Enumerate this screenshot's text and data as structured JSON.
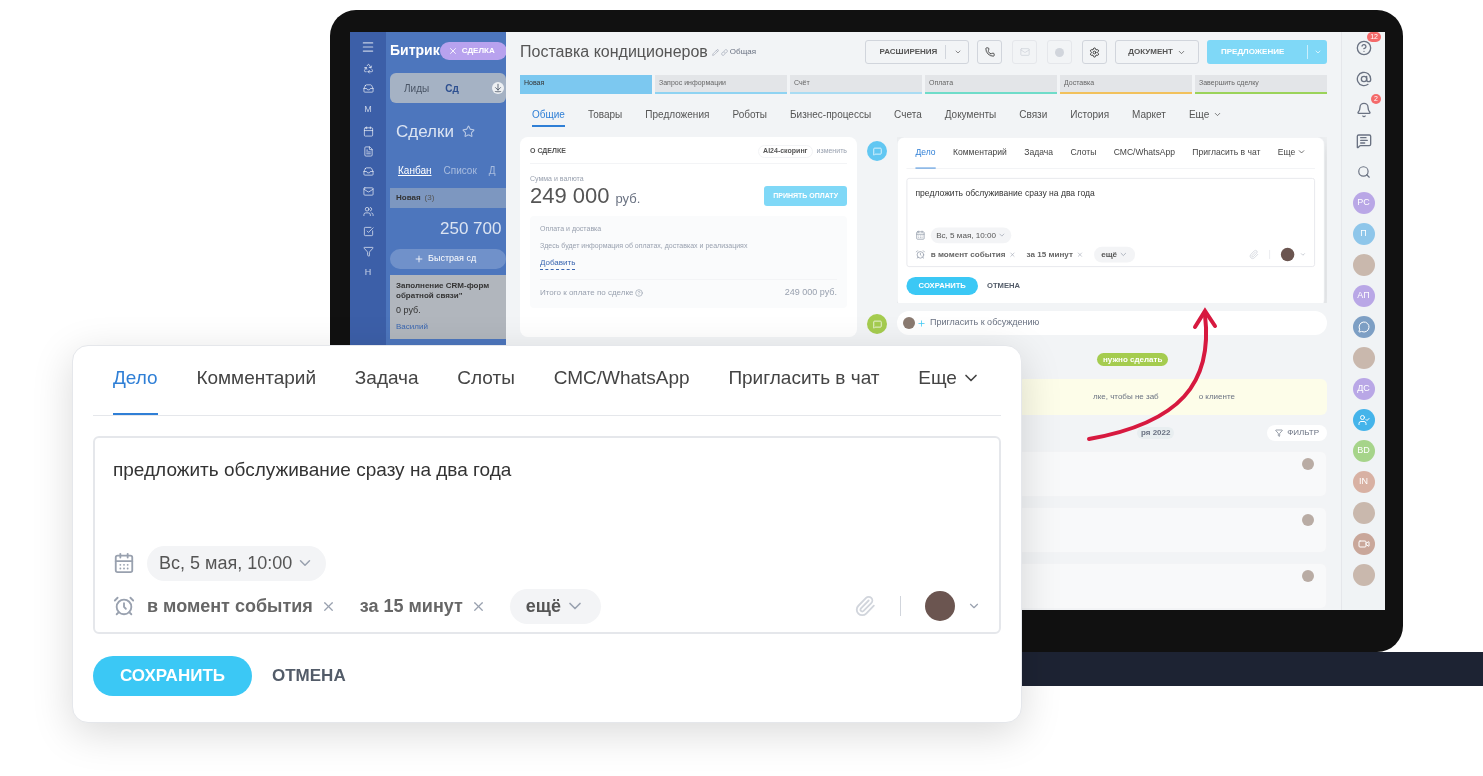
{
  "sidebar": {
    "logo_text": "Битрик",
    "slider_label": "СДЕЛКА",
    "letters": [
      "М",
      "Н"
    ],
    "tabs": [
      {
        "label": "Лиды",
        "selected": false
      },
      {
        "label": "Сд",
        "selected": true
      }
    ],
    "heading": "Сделки",
    "views": [
      {
        "label": "Канбан",
        "selected": true
      },
      {
        "label": "Список",
        "selected": false
      },
      {
        "label": "Д",
        "selected": false
      }
    ],
    "column": {
      "title": "Новая",
      "count": "(3)",
      "sum": "250 700",
      "quick_add": "Быстрая сд"
    },
    "card": {
      "title": [
        "Заполнение CRM-форм",
        "обратной связи\""
      ],
      "amount": "0 руб.",
      "person": "Василий"
    }
  },
  "header": {
    "title": "Поставка кондиционеров",
    "category": "Общая",
    "extensions": "РАСШИРЕНИЯ",
    "document": "ДОКУМЕНТ",
    "offer": "ПРЕДЛОЖЕНИЕ"
  },
  "stages": [
    {
      "label": "Новая",
      "selected": true,
      "color": "#7cc8f0"
    },
    {
      "label": "Запрос информации",
      "selected": false,
      "color": "#8fd3f2"
    },
    {
      "label": "Счёт",
      "selected": false,
      "color": "#a9dcf3"
    },
    {
      "label": "Оплата",
      "selected": false,
      "color": "#6fdcc9"
    },
    {
      "label": "Доставка",
      "selected": false,
      "color": "#f2c15c"
    },
    {
      "label": "Завершить сделку",
      "selected": false,
      "color": "#9bd35a"
    }
  ],
  "tabs": [
    {
      "label": "Общие",
      "selected": true
    },
    {
      "label": "Товары",
      "selected": false
    },
    {
      "label": "Предложения",
      "selected": false
    },
    {
      "label": "Роботы",
      "selected": false
    },
    {
      "label": "Бизнес-процессы",
      "selected": false
    },
    {
      "label": "Счета",
      "selected": false
    },
    {
      "label": "Документы",
      "selected": false
    },
    {
      "label": "Связи",
      "selected": false
    },
    {
      "label": "История",
      "selected": false
    },
    {
      "label": "Маркет",
      "selected": false
    },
    {
      "label": "Еще",
      "selected": false
    }
  ],
  "about": {
    "heading": "О СДЕЛКЕ",
    "scoring": "AI24-скоринг",
    "change": "изменить",
    "amount_label": "Сумма и валюта",
    "amount": "249 000",
    "currency": "руб.",
    "pay_button": "ПРИНЯТЬ ОПЛАТУ",
    "payment_title": "Оплата и доставка",
    "payment_hint": "Здесь будет информация об оплатах, доставках и реализациях",
    "add": "Добавить",
    "total_label": "Итого к оплате по сделке",
    "total": "249 000 руб."
  },
  "editor": {
    "tabs": [
      {
        "label": "Дело",
        "selected": true
      },
      {
        "label": "Комментарий",
        "selected": false
      },
      {
        "label": "Задача",
        "selected": false
      },
      {
        "label": "Слоты",
        "selected": false
      },
      {
        "label": "СМС/WhatsApp",
        "selected": false
      },
      {
        "label": "Пригласить в чат",
        "selected": false
      },
      {
        "label": "Еще",
        "selected": false
      }
    ],
    "text": "предложить обслуживание сразу на два года",
    "date": "Вс, 5 мая, 10:00",
    "reminders": [
      "в момент события",
      "за 15 минут"
    ],
    "more": "ещё",
    "save": "СОХРАНИТЬ",
    "cancel": "ОТМЕНА"
  },
  "timeline": {
    "invite": "Пригласить к обсуждению",
    "badge": "нужно сделать",
    "note": [
      "лке, чтобы не заб",
      "о клиенте"
    ],
    "date": "ря 2022",
    "filter": "ФИЛЬТР"
  },
  "right_bar": [
    {
      "kind": "help",
      "badge": "12"
    },
    {
      "kind": "at"
    },
    {
      "kind": "bell",
      "badge": "2"
    },
    {
      "kind": "chat"
    },
    {
      "kind": "search"
    },
    {
      "kind": "initials",
      "text": "PC",
      "color": "#b9a7e6"
    },
    {
      "kind": "initials",
      "text": "П",
      "color": "#8ec6ea"
    },
    {
      "kind": "photo"
    },
    {
      "kind": "initials",
      "text": "АП",
      "color": "#b9a7e6"
    },
    {
      "kind": "group_chat"
    },
    {
      "kind": "photo"
    },
    {
      "kind": "initials",
      "text": "ДС",
      "color": "#b9a7e6"
    },
    {
      "kind": "user_clock"
    },
    {
      "kind": "initials",
      "text": "BD",
      "color": "#a6d48a"
    },
    {
      "kind": "initials",
      "text": "IN",
      "color": "#d8b1a3"
    },
    {
      "kind": "photo"
    },
    {
      "kind": "video"
    },
    {
      "kind": "photo"
    }
  ],
  "zoom_card": {
    "tabs": [
      {
        "label": "Дело",
        "selected": true
      },
      {
        "label": "Комментарий",
        "selected": false
      },
      {
        "label": "Задача",
        "selected": false
      },
      {
        "label": "Слоты",
        "selected": false
      },
      {
        "label": "СМС/WhatsApp",
        "selected": false
      },
      {
        "label": "Пригласить в чат",
        "selected": false
      },
      {
        "label": "Еще",
        "selected": false
      }
    ],
    "text": "предложить обслуживание сразу на два года",
    "date": "Вс, 5 мая, 10:00",
    "reminders": [
      "в момент события",
      "за 15 минут"
    ],
    "more": "ещё",
    "save": "СОХРАНИТЬ",
    "cancel": "ОТМЕНА"
  }
}
